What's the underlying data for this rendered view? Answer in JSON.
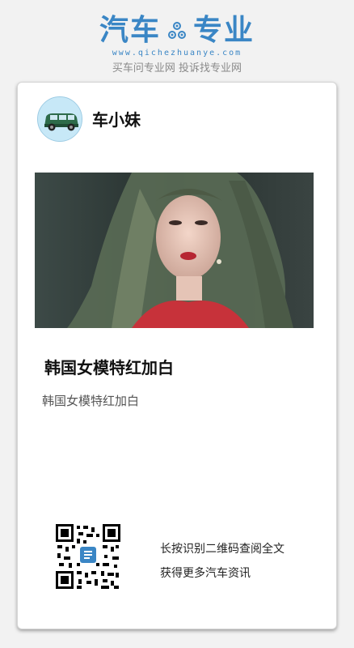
{
  "brand": {
    "title_left": "汽车",
    "title_right": "专业",
    "logo_icon": "gear-icon",
    "url": "www.qichezhuanye.com",
    "slogan": "买车问专业网 投诉找专业网",
    "color": "#3a86c5"
  },
  "author": {
    "avatar_icon": "car-icon",
    "name": "车小妹"
  },
  "article": {
    "title": "韩国女模特红加白",
    "summary": "韩国女模特红加白"
  },
  "share": {
    "qr_icon": "qr-code-icon",
    "line1": "长按识别二维码查阅全文",
    "line2": "获得更多汽车资讯"
  }
}
